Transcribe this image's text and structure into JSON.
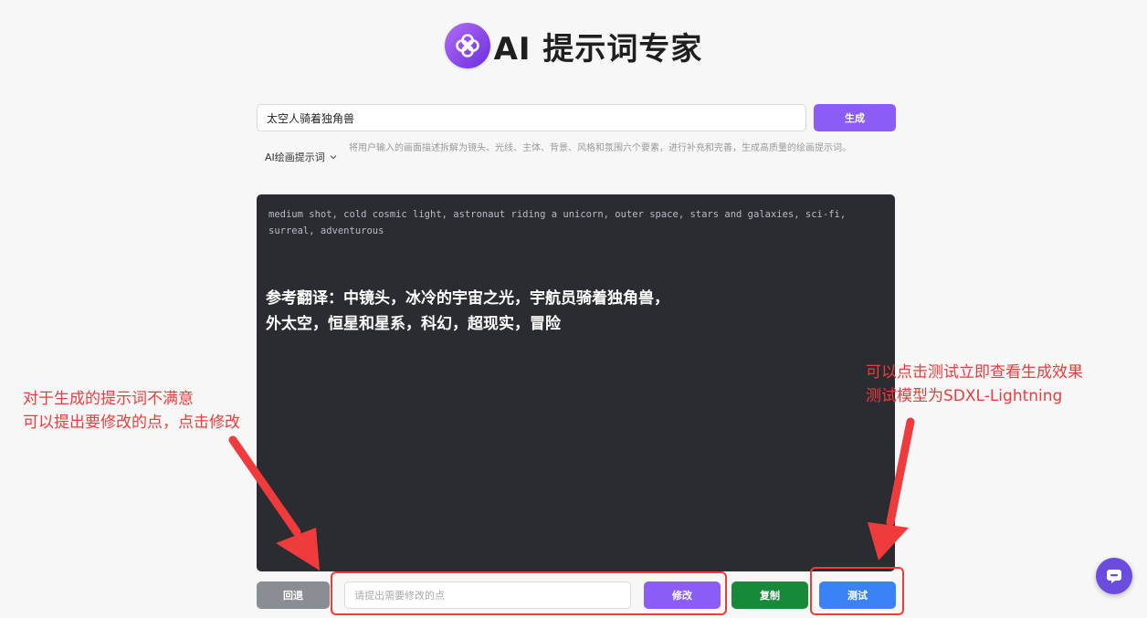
{
  "header": {
    "title": "AI 提示词专家"
  },
  "prompt": {
    "value": "太空人骑着独角兽",
    "generate_label": "生成"
  },
  "mode": {
    "selected": "AI绘画提示词",
    "description": "将用户输入的画面描述拆解为镜头、光线、主体、背景、风格和氛围六个要素，进行补充和完善，生成高质量的绘画提示词。"
  },
  "output": {
    "english_lines": [
      "medium shot, cold cosmic light, astronaut riding a unicorn, outer space, stars and galaxies, sci-fi,",
      "surreal, adventurous"
    ],
    "translation_lines": [
      "参考翻译：中镜头，冰冷的宇宙之光，宇航员骑着独角兽，",
      "外太空，恒星和星系，科幻，超现实，冒险"
    ]
  },
  "actions": {
    "back_label": "回退",
    "modify_placeholder": "请提出需要修改的点",
    "modify_label": "修改",
    "copy_label": "复制",
    "test_label": "测试"
  },
  "annotations": {
    "left": [
      "对于生成的提示词不满意",
      "可以提出要修改的点，点击修改"
    ],
    "right": [
      "可以点击测试立即查看生成效果",
      "测试模型为SDXL-Lightning"
    ]
  },
  "colors": {
    "accent_purple": "#8b5cf6",
    "copy_green": "#178a3a",
    "test_blue": "#3b82f6",
    "annotation_red": "#ef3b3b",
    "panel_dark": "#2a2c31"
  },
  "icons": {
    "logo": "flower-logo-icon",
    "mode_dropdown": "chevron-down-icon",
    "chat": "chat-bubble-icon"
  }
}
